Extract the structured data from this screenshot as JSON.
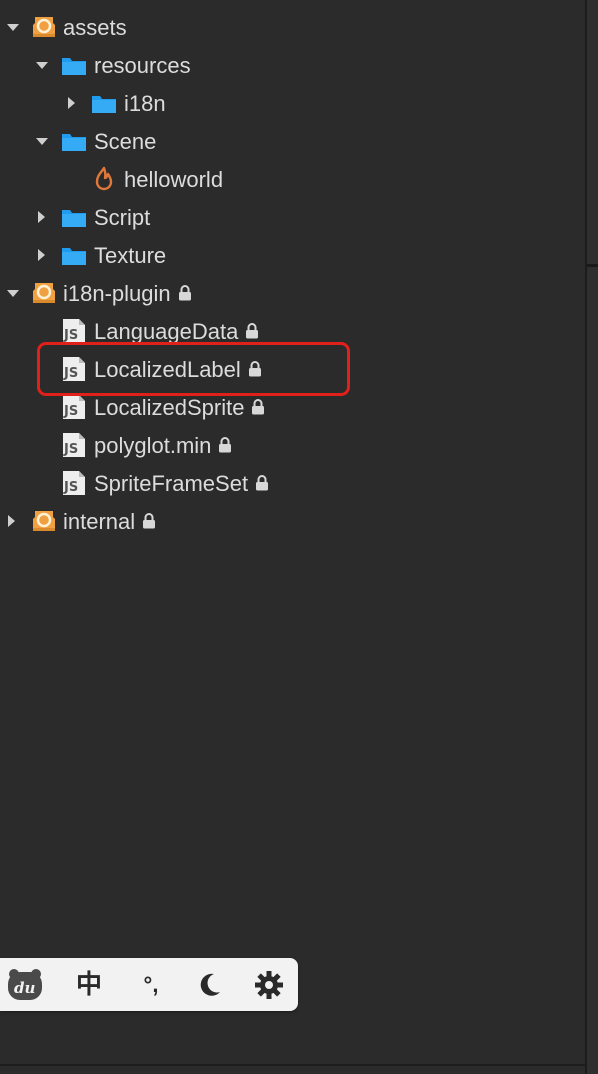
{
  "tree": {
    "assets": {
      "label": "assets"
    },
    "resources": {
      "label": "resources"
    },
    "i18n": {
      "label": "i18n"
    },
    "scene": {
      "label": "Scene"
    },
    "helloworld": {
      "label": "helloworld"
    },
    "script": {
      "label": "Script"
    },
    "texture": {
      "label": "Texture"
    },
    "plugin": {
      "label": "i18n-plugin"
    },
    "languagedata": {
      "label": "LanguageData"
    },
    "localizedlabel": {
      "label": "LocalizedLabel"
    },
    "localizedsprite": {
      "label": "LocalizedSprite"
    },
    "polyglot": {
      "label": "polyglot.min"
    },
    "spriteframeset": {
      "label": "SpriteFrameSet"
    },
    "internal": {
      "label": "internal"
    }
  },
  "js_badge": "JS",
  "ime": {
    "logo": "du",
    "chinese": "中",
    "punct": "°,",
    "icons": [
      "baidu-logo-icon",
      "chinese-mode-icon",
      "punctuation-icon",
      "moon-icon",
      "gear-icon"
    ]
  },
  "colors": {
    "background": "#2b2b2b",
    "folder_blue": "#1f9cf0",
    "db_orange": "#f0a040",
    "highlight_red": "#e0201b",
    "fire_orange": "#e0783a"
  }
}
